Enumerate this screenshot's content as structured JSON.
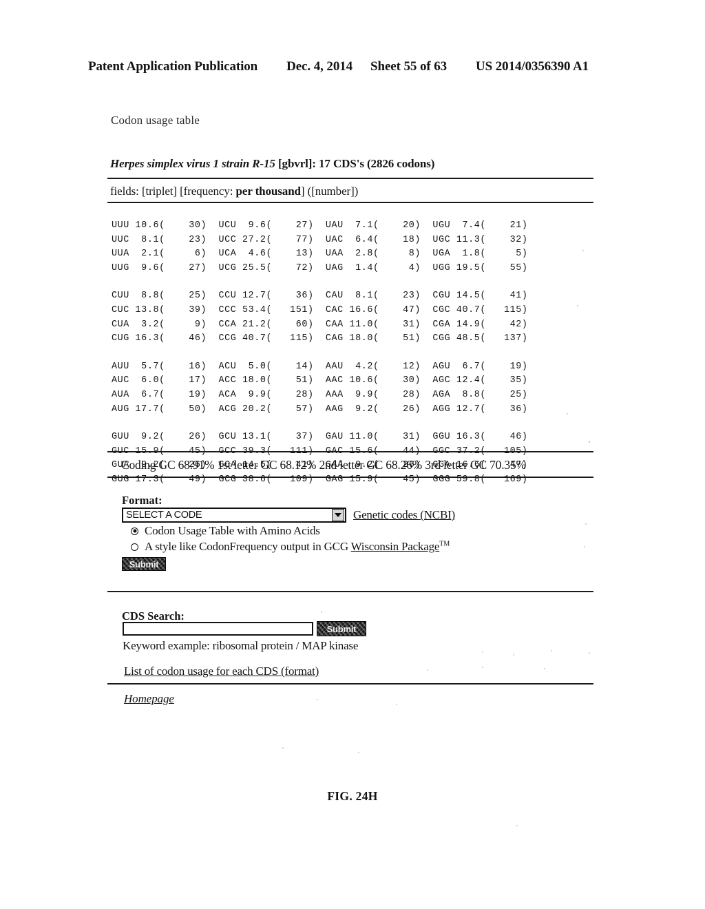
{
  "page_header": {
    "publication": "Patent Application Publication",
    "date": "Dec. 4, 2014",
    "sheet": "Sheet 55 of 63",
    "patent_number": "US 2014/0356390 A1"
  },
  "document": {
    "caption_top": "Codon usage table",
    "organism_title_italic": "Herpes simplex virus 1 strain R-15",
    "organism_title_rest": " [gbvrl]: 17 CDS's (2826 codons)",
    "fields_prefix": "fields: [triplet] [frequency: ",
    "fields_bold": "per thousand",
    "fields_suffix": "] ([number])",
    "gc_line": "Coding GC 68.91% 1st letter GC 68.12% 2nd letter GC 68.26% 3rd letter GC 70.35%",
    "figure_caption": "FIG. 24H"
  },
  "codon_table": {
    "columns": 4,
    "blocks": [
      {
        "rows": [
          [
            {
              "codon": "UUU",
              "freq": "10.6",
              "count": "30"
            },
            {
              "codon": "UCU",
              "freq": "9.6",
              "count": "27"
            },
            {
              "codon": "UAU",
              "freq": "7.1",
              "count": "20"
            },
            {
              "codon": "UGU",
              "freq": "7.4",
              "count": "21"
            }
          ],
          [
            {
              "codon": "UUC",
              "freq": "8.1",
              "count": "23"
            },
            {
              "codon": "UCC",
              "freq": "27.2",
              "count": "77"
            },
            {
              "codon": "UAC",
              "freq": "6.4",
              "count": "18"
            },
            {
              "codon": "UGC",
              "freq": "11.3",
              "count": "32"
            }
          ],
          [
            {
              "codon": "UUA",
              "freq": "2.1",
              "count": "6"
            },
            {
              "codon": "UCA",
              "freq": "4.6",
              "count": "13"
            },
            {
              "codon": "UAA",
              "freq": "2.8",
              "count": "8"
            },
            {
              "codon": "UGA",
              "freq": "1.8",
              "count": "5"
            }
          ],
          [
            {
              "codon": "UUG",
              "freq": "9.6",
              "count": "27"
            },
            {
              "codon": "UCG",
              "freq": "25.5",
              "count": "72"
            },
            {
              "codon": "UAG",
              "freq": "1.4",
              "count": "4"
            },
            {
              "codon": "UGG",
              "freq": "19.5",
              "count": "55"
            }
          ]
        ]
      },
      {
        "rows": [
          [
            {
              "codon": "CUU",
              "freq": "8.8",
              "count": "25"
            },
            {
              "codon": "CCU",
              "freq": "12.7",
              "count": "36"
            },
            {
              "codon": "CAU",
              "freq": "8.1",
              "count": "23"
            },
            {
              "codon": "CGU",
              "freq": "14.5",
              "count": "41"
            }
          ],
          [
            {
              "codon": "CUC",
              "freq": "13.8",
              "count": "39"
            },
            {
              "codon": "CCC",
              "freq": "53.4",
              "count": "151"
            },
            {
              "codon": "CAC",
              "freq": "16.6",
              "count": "47"
            },
            {
              "codon": "CGC",
              "freq": "40.7",
              "count": "115"
            }
          ],
          [
            {
              "codon": "CUA",
              "freq": "3.2",
              "count": "9"
            },
            {
              "codon": "CCA",
              "freq": "21.2",
              "count": "60"
            },
            {
              "codon": "CAA",
              "freq": "11.0",
              "count": "31"
            },
            {
              "codon": "CGA",
              "freq": "14.9",
              "count": "42"
            }
          ],
          [
            {
              "codon": "CUG",
              "freq": "16.3",
              "count": "46"
            },
            {
              "codon": "CCG",
              "freq": "40.7",
              "count": "115"
            },
            {
              "codon": "CAG",
              "freq": "18.0",
              "count": "51"
            },
            {
              "codon": "CGG",
              "freq": "48.5",
              "count": "137"
            }
          ]
        ]
      },
      {
        "rows": [
          [
            {
              "codon": "AUU",
              "freq": "5.7",
              "count": "16"
            },
            {
              "codon": "ACU",
              "freq": "5.0",
              "count": "14"
            },
            {
              "codon": "AAU",
              "freq": "4.2",
              "count": "12"
            },
            {
              "codon": "AGU",
              "freq": "6.7",
              "count": "19"
            }
          ],
          [
            {
              "codon": "AUC",
              "freq": "6.0",
              "count": "17"
            },
            {
              "codon": "ACC",
              "freq": "18.0",
              "count": "51"
            },
            {
              "codon": "AAC",
              "freq": "10.6",
              "count": "30"
            },
            {
              "codon": "AGC",
              "freq": "12.4",
              "count": "35"
            }
          ],
          [
            {
              "codon": "AUA",
              "freq": "6.7",
              "count": "19"
            },
            {
              "codon": "ACA",
              "freq": "9.9",
              "count": "28"
            },
            {
              "codon": "AAA",
              "freq": "9.9",
              "count": "28"
            },
            {
              "codon": "AGA",
              "freq": "8.8",
              "count": "25"
            }
          ],
          [
            {
              "codon": "AUG",
              "freq": "17.7",
              "count": "50"
            },
            {
              "codon": "ACG",
              "freq": "20.2",
              "count": "57"
            },
            {
              "codon": "AAG",
              "freq": "9.2",
              "count": "26"
            },
            {
              "codon": "AGG",
              "freq": "12.7",
              "count": "36"
            }
          ]
        ]
      },
      {
        "rows": [
          [
            {
              "codon": "GUU",
              "freq": "9.2",
              "count": "26"
            },
            {
              "codon": "GCU",
              "freq": "13.1",
              "count": "37"
            },
            {
              "codon": "GAU",
              "freq": "11.0",
              "count": "31"
            },
            {
              "codon": "GGU",
              "freq": "16.3",
              "count": "46"
            }
          ],
          [
            {
              "codon": "GUC",
              "freq": "15.9",
              "count": "45"
            },
            {
              "codon": "GCC",
              "freq": "39.3",
              "count": "111"
            },
            {
              "codon": "GAC",
              "freq": "15.6",
              "count": "44"
            },
            {
              "codon": "GGC",
              "freq": "37.2",
              "count": "105"
            }
          ],
          [
            {
              "codon": "GUA",
              "freq": "9.2",
              "count": "26"
            },
            {
              "codon": "GCA",
              "freq": "14.5",
              "count": "41"
            },
            {
              "codon": "GAA",
              "freq": "9.2",
              "count": "26"
            },
            {
              "codon": "GGA",
              "freq": "16.6",
              "count": "47"
            }
          ],
          [
            {
              "codon": "GUG",
              "freq": "17.3",
              "count": "49"
            },
            {
              "codon": "GCG",
              "freq": "38.6",
              "count": "109"
            },
            {
              "codon": "GAG",
              "freq": "15.9",
              "count": "45"
            },
            {
              "codon": "GGG",
              "freq": "59.8",
              "count": "169"
            }
          ]
        ]
      }
    ]
  },
  "format_section": {
    "label": "Format:",
    "select_value": "SELECT A CODE",
    "select_icon": "chevron-down-icon",
    "genetic_codes_link": "Genetic codes (NCBI)",
    "radio_1_label": "Codon Usage Table with Amino Acids",
    "radio_1_selected": true,
    "radio_2_prefix": "A style like CodonFrequency output in GCG ",
    "radio_2_link": "Wisconsin Package",
    "radio_2_tm": "TM",
    "radio_2_selected": false,
    "submit_label": "Submit"
  },
  "cds_section": {
    "label": "CDS Search:",
    "input_value": "",
    "input_placeholder": "",
    "submit_label": "Submit",
    "keyword_example": "Keyword example: ribosomal protein / MAP kinase",
    "list_link": "List of codon usage for each CDS (format)",
    "homepage_link": "Homepage"
  }
}
